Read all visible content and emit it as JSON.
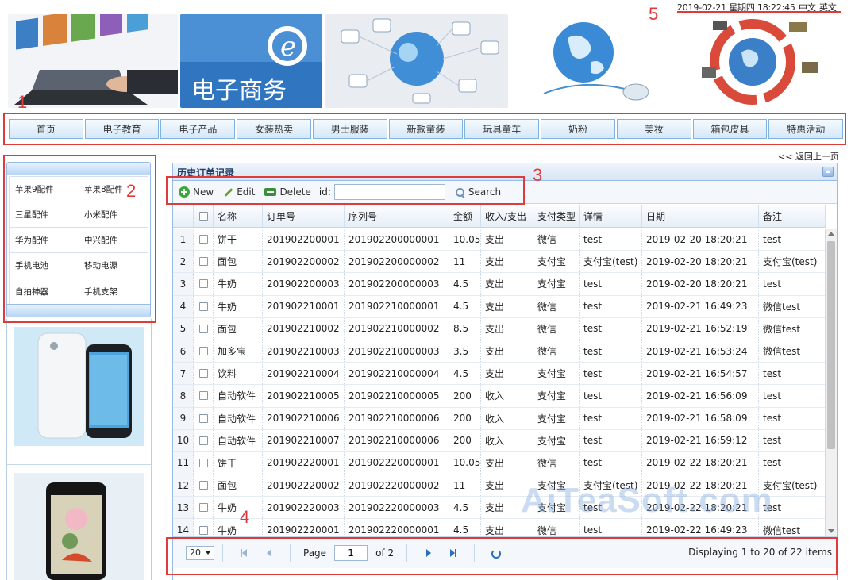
{
  "header": {
    "datetime": "2019-02-21 星期四 18:22:45",
    "lang_cn": "中文",
    "lang_en": "英文",
    "banner_ecommerce_text": "电子商务"
  },
  "nav": {
    "items": [
      "首页",
      "电子教育",
      "电子产品",
      "女装热卖",
      "男士服装",
      "新款童装",
      "玩具童车",
      "奶粉",
      "美妆",
      "箱包皮具",
      "特惠活动"
    ]
  },
  "sidebar": {
    "rows": [
      [
        "苹果9配件",
        "苹果8配件"
      ],
      [
        "三星配件",
        "小米配件"
      ],
      [
        "华为配件",
        "中兴配件"
      ],
      [
        "手机电池",
        "移动电源"
      ],
      [
        "自拍神器",
        "手机支架"
      ]
    ]
  },
  "main": {
    "back_link": "<< 返回上一页",
    "title": "历史订单记录",
    "toolbar": {
      "new_label": "New",
      "edit_label": "Edit",
      "delete_label": "Delete",
      "id_label": "id:",
      "id_value": "",
      "search_label": "Search"
    },
    "columns": [
      "名称",
      "订单号",
      "序列号",
      "金额",
      "收入/支出",
      "支付类型",
      "详情",
      "日期",
      "备注"
    ],
    "rows": [
      [
        "1",
        "饼干",
        "201902200001",
        "201902200000001",
        "10.05",
        "支出",
        "微信",
        "test",
        "2019-02-20 18:20:21",
        "test"
      ],
      [
        "2",
        "面包",
        "201902200002",
        "201902200000002",
        "11",
        "支出",
        "支付宝",
        "支付宝(test)",
        "2019-02-20 18:20:21",
        "支付宝(test)"
      ],
      [
        "3",
        "牛奶",
        "201902200003",
        "201902200000003",
        "4.5",
        "支出",
        "支付宝",
        "test",
        "2019-02-20 18:20:21",
        "test"
      ],
      [
        "4",
        "牛奶",
        "201902210001",
        "201902210000001",
        "4.5",
        "支出",
        "微信",
        "test",
        "2019-02-21 16:49:23",
        "微信test"
      ],
      [
        "5",
        "面包",
        "201902210002",
        "201902210000002",
        "8.5",
        "支出",
        "微信",
        "test",
        "2019-02-21 16:52:19",
        "微信test"
      ],
      [
        "6",
        "加多宝",
        "201902210003",
        "201902210000003",
        "3.5",
        "支出",
        "微信",
        "test",
        "2019-02-21 16:53:24",
        "微信test"
      ],
      [
        "7",
        "饮料",
        "201902210004",
        "201902210000004",
        "4.5",
        "支出",
        "支付宝",
        "test",
        "2019-02-21 16:54:57",
        "test"
      ],
      [
        "8",
        "自动软件",
        "201902210005",
        "201902210000005",
        "200",
        "收入",
        "支付宝",
        "test",
        "2019-02-21 16:56:09",
        "test"
      ],
      [
        "9",
        "自动软件",
        "201902210006",
        "201902210000006",
        "200",
        "收入",
        "支付宝",
        "test",
        "2019-02-21 16:58:09",
        "test"
      ],
      [
        "10",
        "自动软件",
        "201902210007",
        "201902210000006",
        "200",
        "收入",
        "支付宝",
        "test",
        "2019-02-21 16:59:12",
        "test"
      ],
      [
        "11",
        "饼干",
        "201902220001",
        "201902220000001",
        "10.05",
        "支出",
        "微信",
        "test",
        "2019-02-22 18:20:21",
        "test"
      ],
      [
        "12",
        "面包",
        "201902220002",
        "201902220000002",
        "11",
        "支出",
        "支付宝",
        "支付宝(test)",
        "2019-02-22 18:20:21",
        "支付宝(test)"
      ],
      [
        "13",
        "牛奶",
        "201902220003",
        "201902220000003",
        "4.5",
        "支出",
        "支付宝",
        "test",
        "2019-02-22 18:20:21",
        "test"
      ],
      [
        "14",
        "牛奶",
        "201902220001",
        "201902220000001",
        "4.5",
        "支出",
        "微信",
        "test",
        "2019-02-22 16:49:23",
        "微信test"
      ]
    ],
    "pager": {
      "page_size": "20",
      "page_label": "Page",
      "page_value": "1",
      "of_label": "of 2",
      "display_info": "Displaying 1 to 20 of 22 items"
    }
  },
  "annotations": [
    "1",
    "2",
    "3",
    "4",
    "5"
  ],
  "watermark": "AiTeaSoft.com"
}
